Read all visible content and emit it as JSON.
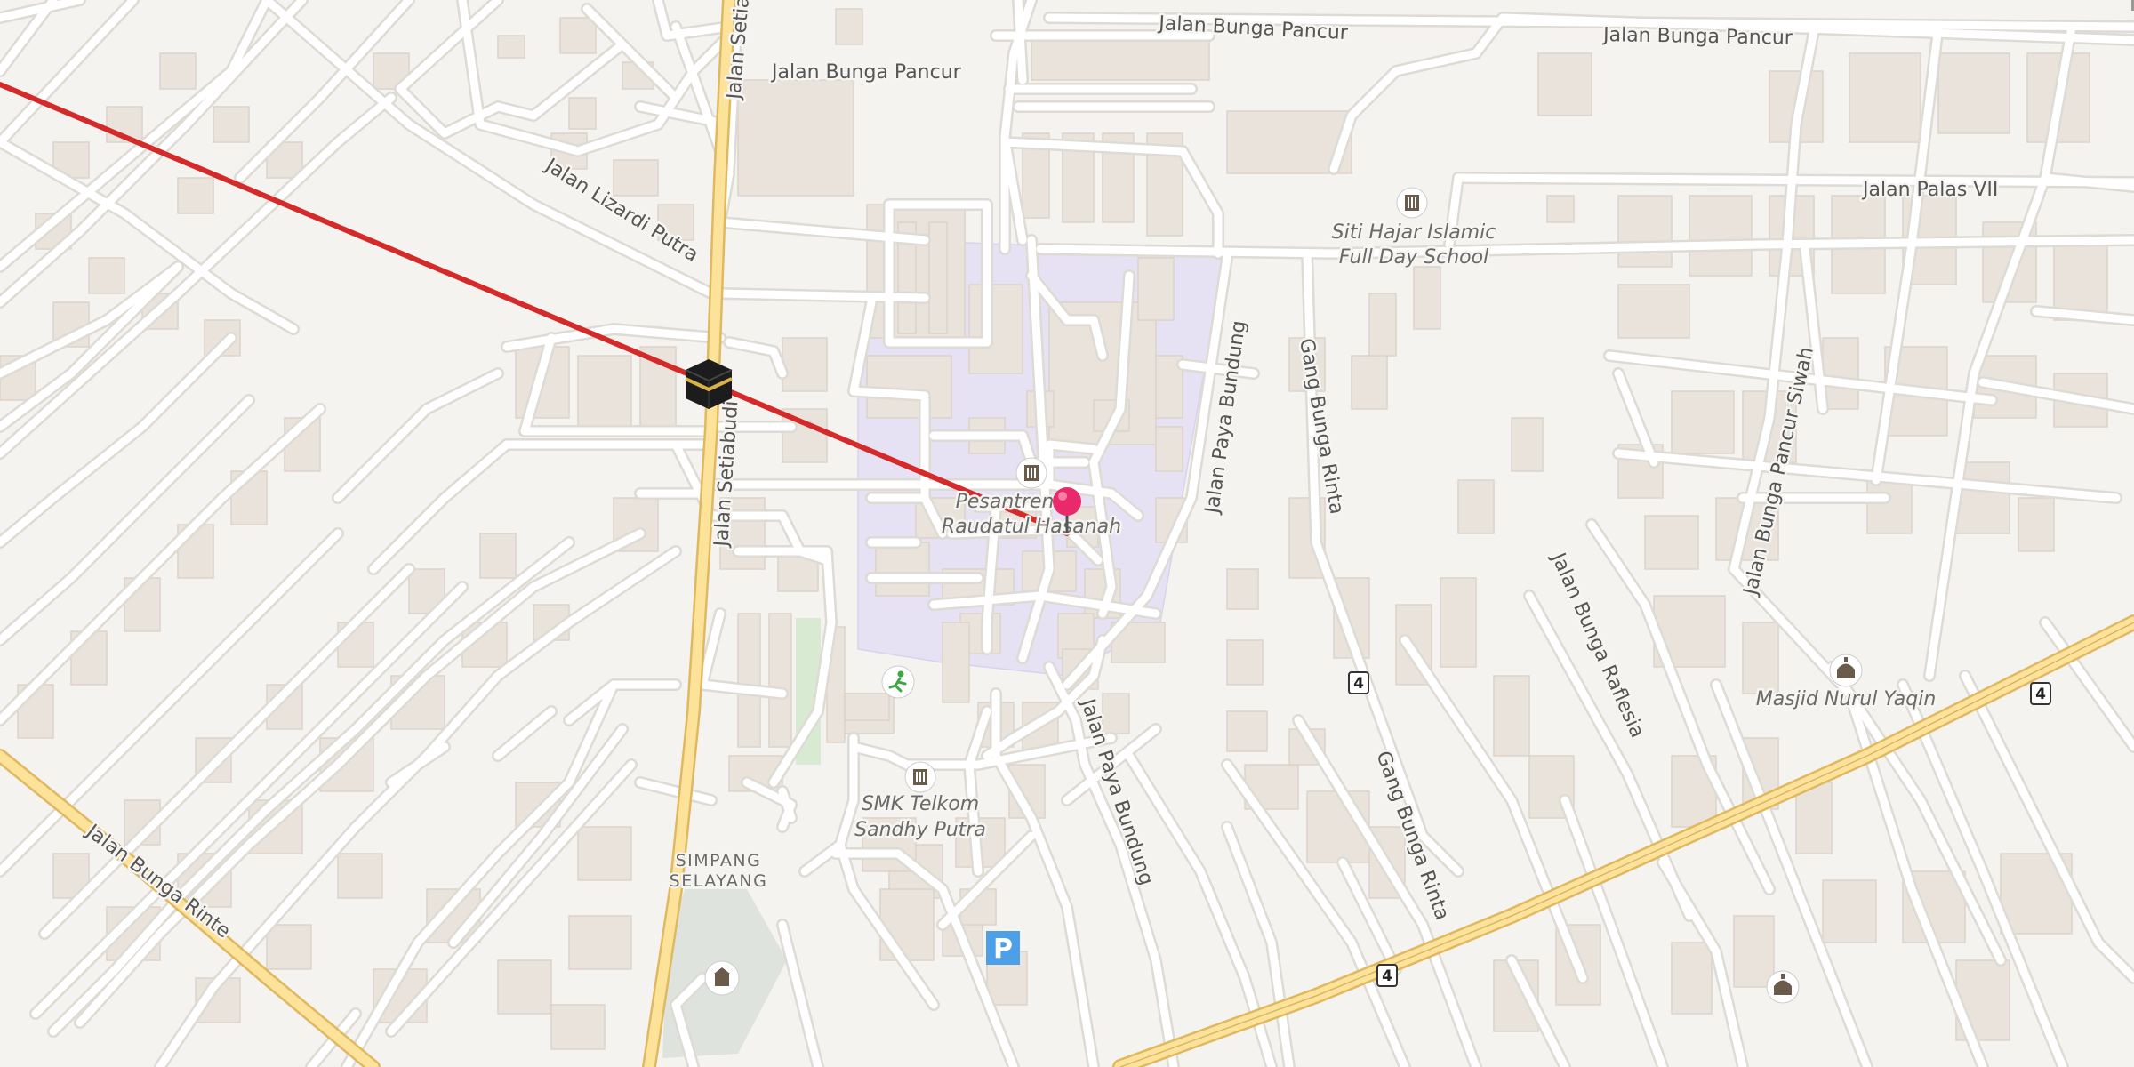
{
  "map": {
    "streets": {
      "bunga_pancur_1": "Jalan Bunga Pancur",
      "bunga_pancur_2": "Jalan Bunga Pancur",
      "bunga_pancur_3": "Jalan Bunga Pancur",
      "setiabudi_top": "Jalan Setiabudi",
      "setiabudi": "Jalan Setiabudi",
      "lizardi_putra": "Jalan Lizardi Putra",
      "palas_vii": "Jalan Palas VII",
      "paya_bundung_1": "Jalan Paya Bundung",
      "paya_bundung_2": "Jalan Paya Bundung",
      "gang_bunga_rinta_1": "Gang Bunga Rinta",
      "gang_bunga_rinta_2": "Gang Bunga Rinta",
      "bunga_rafflesia": "Jalan Bunga Raflesia",
      "bunga_pancur_siwah": "Jalan Bunga Pancur Siwah",
      "bunga_rinte": "Jalan Bunga Rinte"
    },
    "pois": {
      "siti_hajar_line1": "Siti Hajar Islamic",
      "siti_hajar_line2": "Full Day School",
      "pesantren_line1": "Pesantren",
      "pesantren_line2": "Raudatul Hasanah",
      "smk_line1": "SMK Telkom",
      "smk_line2": "Sandhy Putra",
      "masjid": "Masjid Nurul Yaqin"
    },
    "area": {
      "line1": "SIMPANG",
      "line2": "SELAYANG"
    },
    "route_shields": [
      "4",
      "4",
      "4"
    ],
    "parking_label": "P",
    "colors": {
      "background": "#f5f3f0",
      "building": "#e9e3dc",
      "school_area": "#e6e1f3",
      "major_road": "#fde39a",
      "qibla_line": "#d42a2a",
      "marker": "#e8296b",
      "parking": "#4d9fe8"
    },
    "icons": [
      "kaaba-icon",
      "location-pin-icon",
      "school-icon",
      "mosque-icon",
      "sports-icon",
      "parking-icon",
      "monument-icon"
    ]
  }
}
